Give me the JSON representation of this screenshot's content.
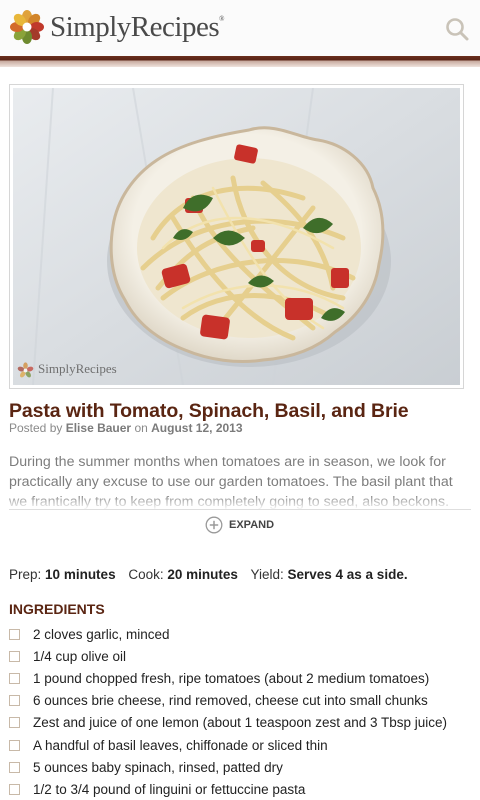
{
  "header": {
    "brand": "SimplyRecipes",
    "brand_mark": "®",
    "logo_icon": "flower-logo-icon",
    "search_icon": "search-icon",
    "bar_color": "#5a2416"
  },
  "photo": {
    "watermark": "SimplyRecipes",
    "icon": "flower-logo-icon"
  },
  "recipe": {
    "title": "Pasta with Tomato, Spinach, Basil, and Brie",
    "posted_by_prefix": "Posted by",
    "author": "Elise Bauer",
    "on_word": "on",
    "date": "August 12, 2013",
    "intro": "During the summer months when tomatoes are in season, we look for practically any excuse to use our garden tomatoes. The basil plant that we frantically try to keep from completely going to seed, also beckons. \"The time is NOW,\" the garden seems to say, \"It has been a long summer.\"",
    "expand_label": "EXPAND",
    "expand_icon": "plus-circle-icon",
    "title_color": "#5a2512"
  },
  "meta": {
    "prep_label": "Prep:",
    "prep_value": "10 minutes",
    "cook_label": "Cook:",
    "cook_value": "20 minutes",
    "yield_label": "Yield:",
    "yield_value": "Serves 4 as a side."
  },
  "ingredients": {
    "heading": "INGREDIENTS",
    "items": [
      "2 cloves garlic, minced",
      "1/4 cup olive oil",
      "1 pound chopped fresh, ripe tomatoes (about 2 medium tomatoes)",
      "6 ounces brie cheese, rind removed, cheese cut into small chunks",
      "Zest and juice of one lemon (about 1 teaspoon zest and 3 Tbsp juice)",
      "A handful of basil leaves, chiffonade or sliced thin",
      "5 ounces baby spinach, rinsed, patted dry",
      "1/2 to 3/4 pound of linguini or fettuccine pasta"
    ]
  }
}
